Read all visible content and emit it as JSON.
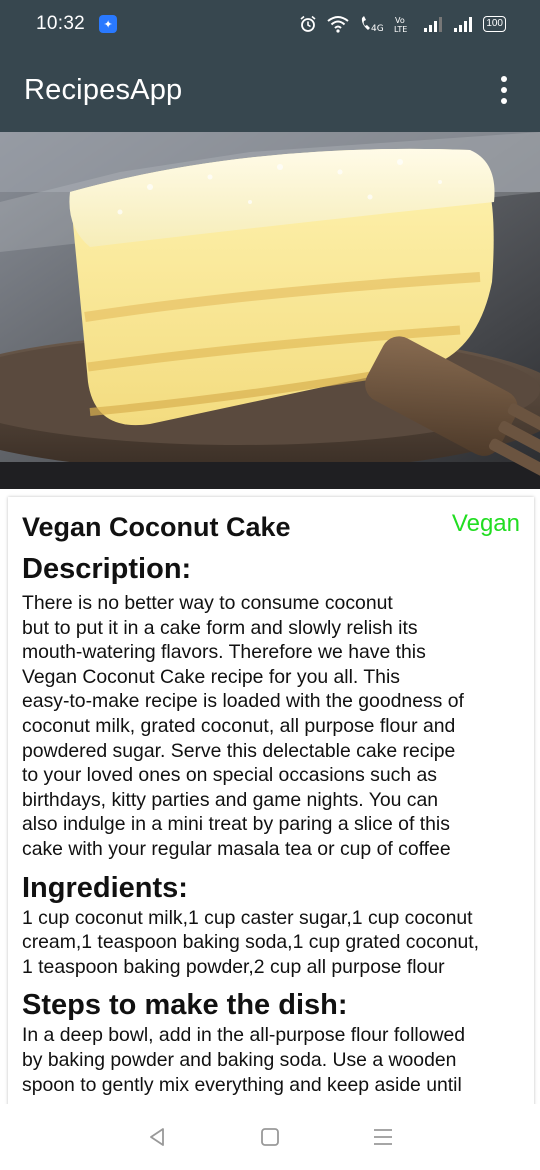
{
  "status_bar": {
    "time": "10:32",
    "battery": "100",
    "icons": [
      "app-notification-icon",
      "alarm-icon",
      "wifi-icon",
      "volte-call-icon",
      "volte-lte-icon",
      "signal-icon-1",
      "signal-icon-2",
      "battery-icon"
    ]
  },
  "app_bar": {
    "title": "RecipesApp",
    "menu_icon": "more-vert-icon"
  },
  "recipe": {
    "name": "Vegan Coconut Cake",
    "tag": "Vegan",
    "description_title": "Description:",
    "description_lines": [
      "There is no better way to consume coconut",
      "but to put it in a cake form and slowly relish its",
      "mouth-watering flavors. Therefore we have this",
      "Vegan Coconut Cake recipe for you all. This",
      "easy-to-make recipe is loaded with the goodness of",
      "coconut milk, grated coconut, all purpose flour and",
      "powdered sugar. Serve this delectable cake recipe",
      "to your loved ones on special occasions such as",
      "birthdays, kitty parties and game nights. You can",
      "also indulge in a mini treat by paring a slice of this",
      "cake with your regular masala tea or cup of coffee"
    ],
    "ingredients_title": "Ingredients:",
    "ingredients_lines": [
      "1 cup coconut milk,1 cup caster sugar,1 cup coconut",
      "cream,1 teaspoon baking soda,1 cup grated coconut,",
      "1 teaspoon baking powder,2 cup all purpose flour"
    ],
    "steps_title": "Steps to make the dish:",
    "steps_lines": [
      "In a deep bowl, add in the all-purpose flour followed",
      "by baking powder and baking soda. Use a wooden",
      "spoon to gently mix everything and keep aside until"
    ]
  },
  "colors": {
    "app_bar": "#37474f",
    "tag": "#22dd22"
  },
  "nav_bar": {
    "icons": [
      "back-icon",
      "home-icon",
      "recents-icon"
    ]
  }
}
